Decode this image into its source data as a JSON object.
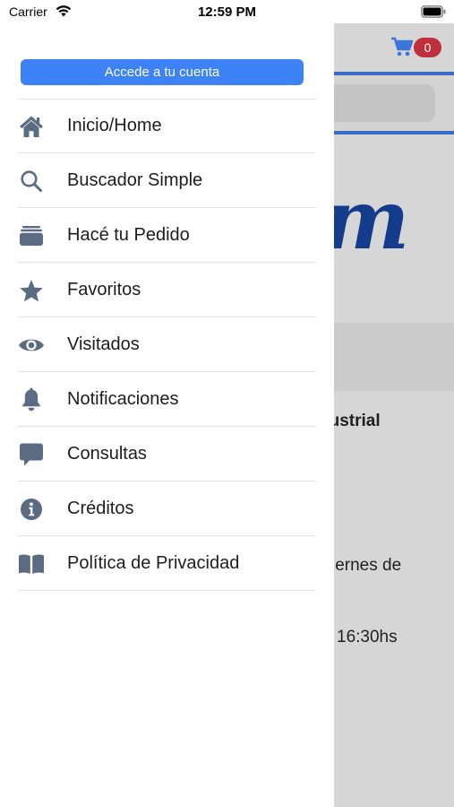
{
  "status_bar": {
    "carrier": "Carrier",
    "time": "12:59 PM"
  },
  "background": {
    "cart_badge": "0",
    "logo_fragment": "m",
    "line1": "dustrial",
    "line2": "iernes de",
    "line3": "16:30hs"
  },
  "drawer": {
    "account_button": "Accede a tu cuenta",
    "items": [
      {
        "label": "Inicio/Home",
        "icon": "home-icon"
      },
      {
        "label": "Buscador Simple",
        "icon": "search-icon"
      },
      {
        "label": "Hacé tu Pedido",
        "icon": "inbox-icon"
      },
      {
        "label": "Favoritos",
        "icon": "star-icon"
      },
      {
        "label": "Visitados",
        "icon": "eye-icon"
      },
      {
        "label": "Notificaciones",
        "icon": "bell-icon"
      },
      {
        "label": "Consultas",
        "icon": "chat-icon"
      },
      {
        "label": "Créditos",
        "icon": "info-icon"
      },
      {
        "label": "Política de Privacidad",
        "icon": "book-icon"
      }
    ]
  },
  "colors": {
    "accent": "#3e82f7",
    "icon": "#5b6b82",
    "badge": "#c0303c",
    "brand": "#143c8c"
  }
}
